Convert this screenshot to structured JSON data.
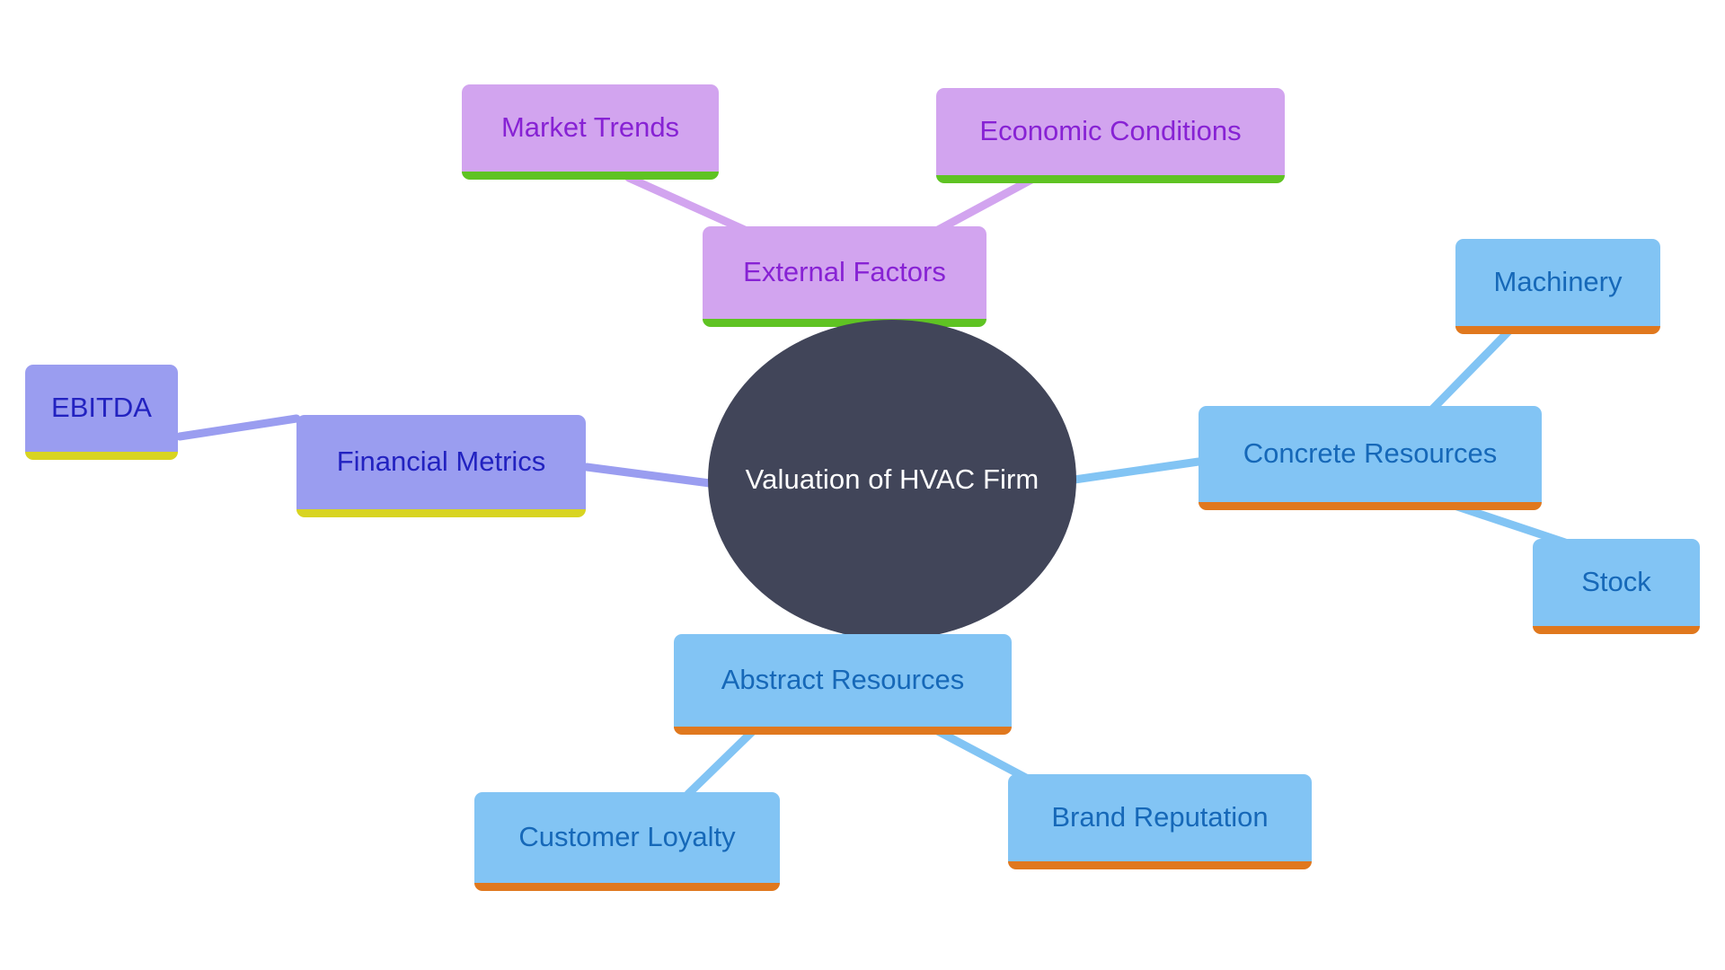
{
  "diagram": {
    "type": "mind-map",
    "title": "Valuation of HVAC Firm",
    "background_color": "#ffffff",
    "root": {
      "id": "root",
      "label": "Valuation of HVAC Firm",
      "shape": "circle",
      "fill": "#414559",
      "text_color": "#ffffff"
    },
    "branches": [
      {
        "id": "external-factors",
        "label": "External Factors",
        "fill": "#d2a4ef",
        "text_color": "#8722d4",
        "accent_color": "#5fc323",
        "children": [
          {
            "id": "market-trends",
            "label": "Market Trends"
          },
          {
            "id": "economic-conditions",
            "label": "Economic Conditions"
          }
        ]
      },
      {
        "id": "financial-metrics",
        "label": "Financial Metrics",
        "fill": "#9a9df0",
        "text_color": "#2222c0",
        "accent_color": "#d8d421",
        "children": [
          {
            "id": "ebitda",
            "label": "EBITDA"
          }
        ]
      },
      {
        "id": "concrete-resources",
        "label": "Concrete Resources",
        "fill": "#82c4f4",
        "text_color": "#1668b8",
        "accent_color": "#e0781e",
        "children": [
          {
            "id": "machinery",
            "label": "Machinery"
          },
          {
            "id": "stock",
            "label": "Stock"
          }
        ]
      },
      {
        "id": "abstract-resources",
        "label": "Abstract Resources",
        "fill": "#82c4f4",
        "text_color": "#1668b8",
        "accent_color": "#e0781e",
        "children": [
          {
            "id": "customer-loyalty",
            "label": "Customer Loyalty"
          },
          {
            "id": "brand-reputation",
            "label": "Brand Reputation"
          }
        ]
      }
    ],
    "edges": [
      {
        "from": "root",
        "to": "external-factors",
        "color": "#d2a4ef"
      },
      {
        "from": "external-factors",
        "to": "market-trends",
        "color": "#d2a4ef"
      },
      {
        "from": "external-factors",
        "to": "economic-conditions",
        "color": "#d2a4ef"
      },
      {
        "from": "root",
        "to": "financial-metrics",
        "color": "#9a9df0"
      },
      {
        "from": "financial-metrics",
        "to": "ebitda",
        "color": "#9a9df0"
      },
      {
        "from": "root",
        "to": "concrete-resources",
        "color": "#82c4f4"
      },
      {
        "from": "concrete-resources",
        "to": "machinery",
        "color": "#82c4f4"
      },
      {
        "from": "concrete-resources",
        "to": "stock",
        "color": "#82c4f4"
      },
      {
        "from": "root",
        "to": "abstract-resources",
        "color": "#82c4f4"
      },
      {
        "from": "abstract-resources",
        "to": "customer-loyalty",
        "color": "#82c4f4"
      },
      {
        "from": "abstract-resources",
        "to": "brand-reputation",
        "color": "#82c4f4"
      }
    ]
  },
  "labels": {
    "root": "Valuation of HVAC Firm",
    "external_factors": "External Factors",
    "market_trends": "Market Trends",
    "economic_conditions": "Economic Conditions",
    "financial_metrics": "Financial Metrics",
    "ebitda": "EBITDA",
    "concrete_resources": "Concrete Resources",
    "machinery": "Machinery",
    "stock": "Stock",
    "abstract_resources": "Abstract Resources",
    "customer_loyalty": "Customer Loyalty",
    "brand_reputation": "Brand Reputation"
  }
}
